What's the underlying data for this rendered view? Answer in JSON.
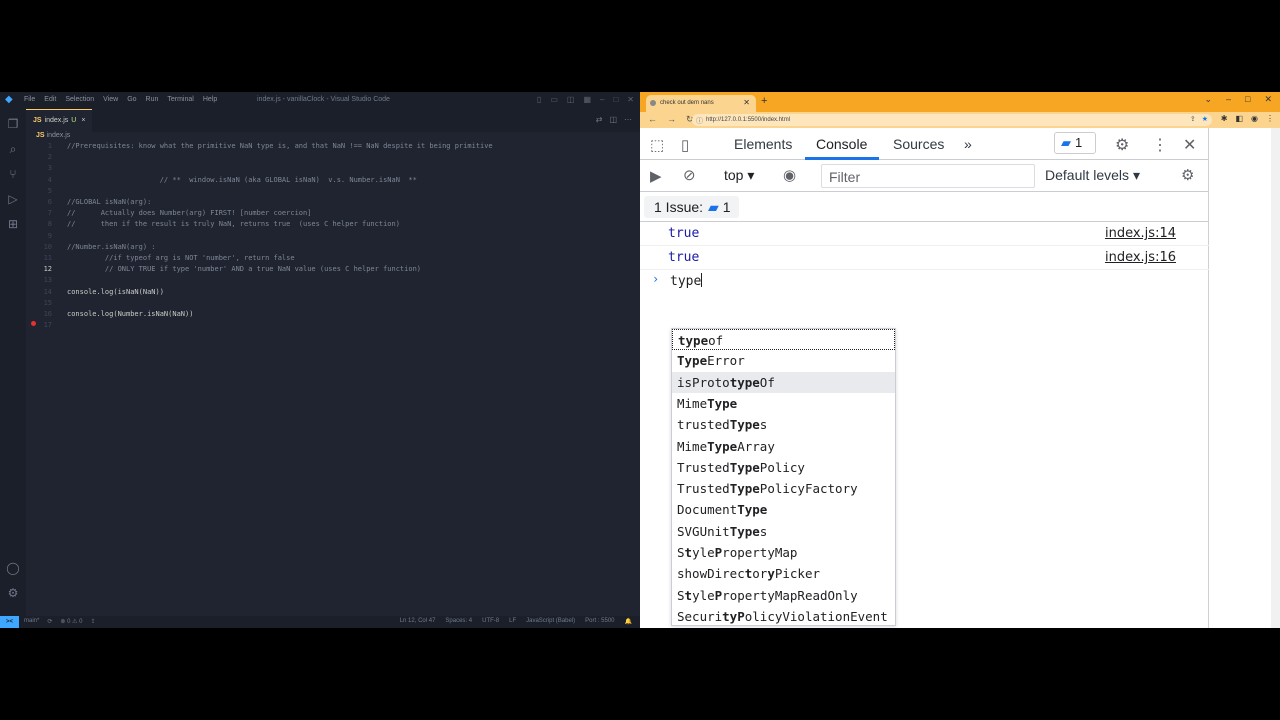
{
  "vscode": {
    "menu": [
      "File",
      "Edit",
      "Selection",
      "View",
      "Go",
      "Run",
      "Terminal",
      "Help"
    ],
    "window_title": "index.js - vanillaClock - Visual Studio Code",
    "tab": {
      "icon": "JS",
      "name": "index.js",
      "status": "U",
      "close": "×"
    },
    "breadcrumb": {
      "icon": "JS",
      "file": "index.js"
    },
    "lines": [
      {
        "n": "1",
        "text": "//Prerequisites: know what the primitive NaN type is, and that NaN !== NaN despite it being primitive"
      },
      {
        "n": "2",
        "text": ""
      },
      {
        "n": "3",
        "text": ""
      },
      {
        "n": "4",
        "text": "                      // **  window.isNaN (aka GLOBAL isNaN)  v.s. Number.isNaN  **"
      },
      {
        "n": "5",
        "text": ""
      },
      {
        "n": "6",
        "text": "//GLOBAL isNaN(arg):"
      },
      {
        "n": "7",
        "text": "//      Actually does Number(arg) FIRST! [number coercion]"
      },
      {
        "n": "8",
        "text": "//      then if the result is truly NaN, returns true  (uses C helper function)"
      },
      {
        "n": "9",
        "text": ""
      },
      {
        "n": "10",
        "text": "//Number.isNaN(arg) :"
      },
      {
        "n": "11",
        "text": "         //if typeof arg is NOT 'number', return false"
      },
      {
        "n": "12",
        "text": "         // ONLY TRUE if type 'number' AND a true NaN value (uses C helper function)"
      },
      {
        "n": "13",
        "text": ""
      },
      {
        "n": "14",
        "text": "console.log(isNaN(NaN))"
      },
      {
        "n": "15",
        "text": ""
      },
      {
        "n": "16",
        "text": "console.log(Number.isNaN(NaN))"
      },
      {
        "n": "17",
        "text": ""
      }
    ],
    "active_line": "12",
    "status": {
      "remote": "><",
      "branch": "main*",
      "errors": "⊗ 0 ⚠ 0",
      "position": "Ln 12, Col 47",
      "spaces": "Spaces: 4",
      "encoding": "UTF-8",
      "eol": "LF",
      "language": "JavaScript (Babel)",
      "port": "Port : 5500"
    }
  },
  "chrome": {
    "tab_title": "check out dem nans",
    "url": "http://127.0.0.1:5500/index.html"
  },
  "devtools": {
    "tabs": [
      "Elements",
      "Console",
      "Sources"
    ],
    "active_tab": "Console",
    "more": "»",
    "issues_count": "1",
    "context": "top",
    "filter_placeholder": "Filter",
    "levels": "Default levels",
    "issues_bar": {
      "label": "1 Issue:",
      "count": "1"
    },
    "messages": [
      {
        "text": "true",
        "source": "index.js:14"
      },
      {
        "text": "true",
        "source": "index.js:16"
      }
    ],
    "input": "type",
    "autocomplete": [
      {
        "pre": "",
        "bold": "type",
        "post": "of",
        "state": "selected"
      },
      {
        "pre": "",
        "bold": "Type",
        "post": "Error",
        "state": ""
      },
      {
        "pre": "isProto",
        "bold": "type",
        "post": "Of",
        "state": "hover"
      },
      {
        "pre": "Mime",
        "bold": "Type",
        "post": "",
        "state": ""
      },
      {
        "pre": "trusted",
        "bold": "Type",
        "post": "s",
        "state": ""
      },
      {
        "pre": "Mime",
        "bold": "Type",
        "post": "Array",
        "state": ""
      },
      {
        "pre": "Trusted",
        "bold": "Type",
        "post": "Policy",
        "state": ""
      },
      {
        "pre": "Trusted",
        "bold": "Type",
        "post": "PolicyFactory",
        "state": ""
      },
      {
        "pre": "Document",
        "bold": "Type",
        "post": "",
        "state": ""
      },
      {
        "pre": "SVGUnit",
        "bold": "Type",
        "post": "s",
        "state": ""
      },
      {
        "pre": "S",
        "bold": "t",
        "post": "yle",
        "tail_bold": "P",
        "rest": "ropertyMap",
        "state": ""
      },
      {
        "pre": "showDirec",
        "bold": "t",
        "post": "or",
        "tail_bold": "y",
        "rest": "Picker",
        "state": ""
      },
      {
        "pre": "S",
        "bold": "t",
        "post": "yle",
        "tail_bold": "P",
        "rest": "ropertyMapReadOnly",
        "state": ""
      },
      {
        "pre": "Securi",
        "bold": "ty",
        "post": "",
        "tail_bold": "P",
        "rest": "olicyViolationEvent",
        "state": ""
      }
    ]
  }
}
